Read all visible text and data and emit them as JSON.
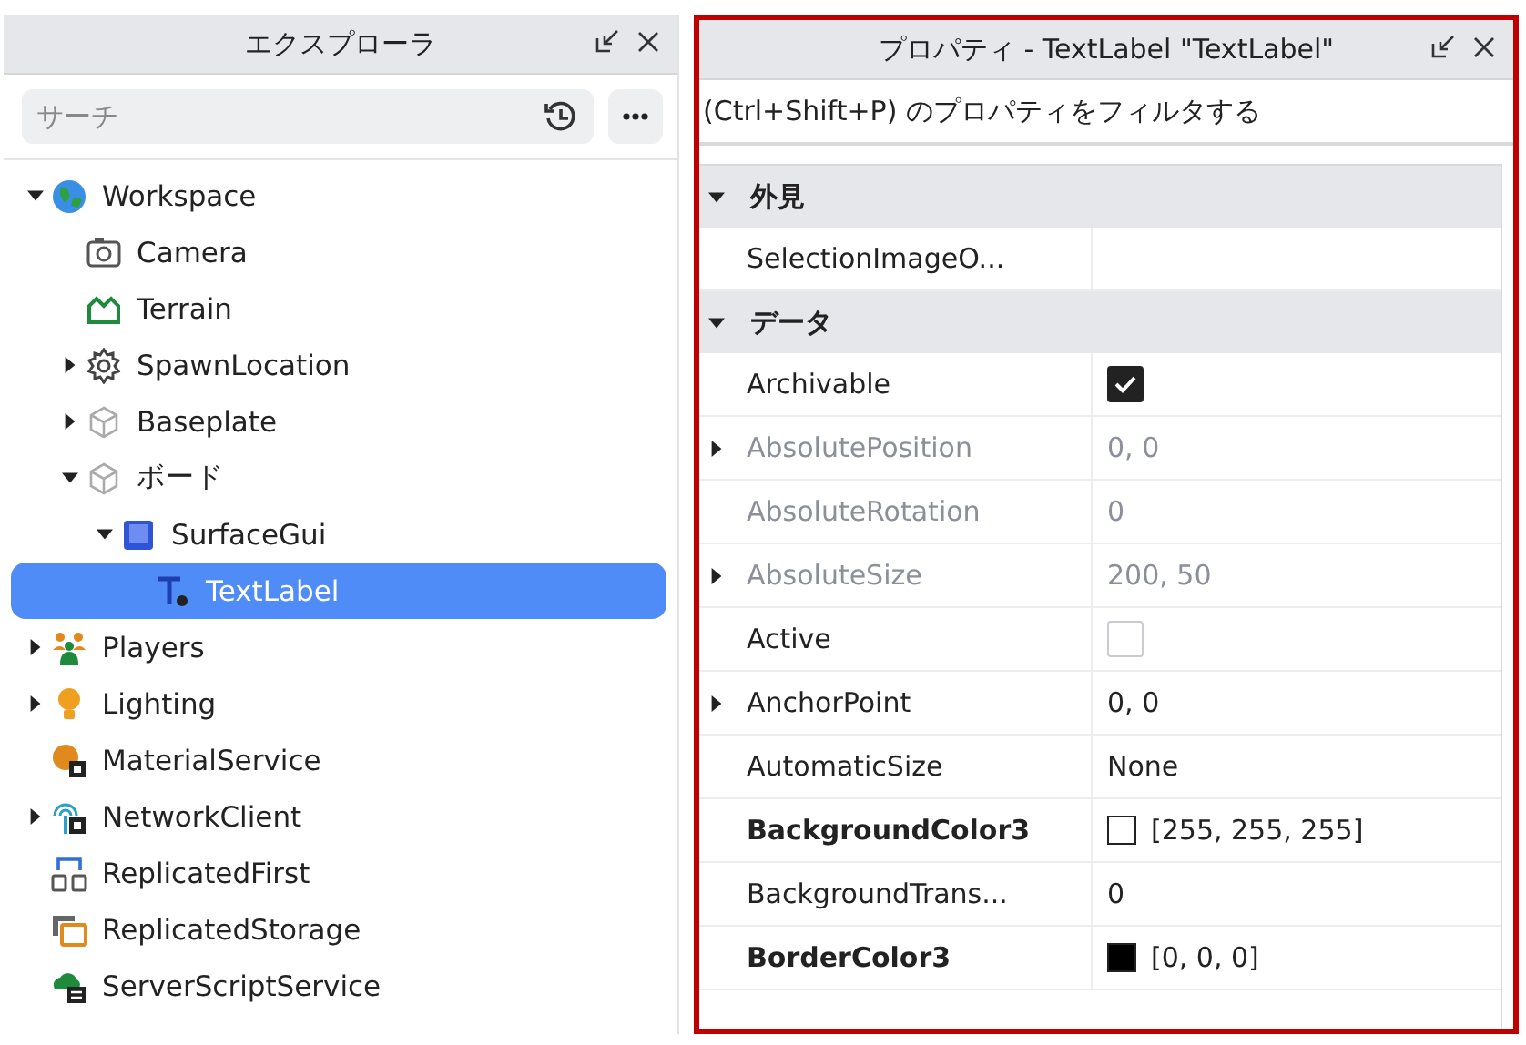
{
  "explorer": {
    "title": "エクスプローラ",
    "search": {
      "placeholder": "サーチ"
    },
    "tree": [
      {
        "label": "Workspace",
        "kind": "globe",
        "expanded": true,
        "selected": false,
        "children": [
          {
            "label": "Camera",
            "kind": "camera",
            "selected": false
          },
          {
            "label": "Terrain",
            "kind": "terrain",
            "selected": false
          },
          {
            "label": "SpawnLocation",
            "kind": "gear",
            "expanded": false,
            "selected": false
          },
          {
            "label": "Baseplate",
            "kind": "cube",
            "expanded": false,
            "selected": false
          },
          {
            "label": "ボード",
            "kind": "cube",
            "expanded": true,
            "selected": false,
            "children": [
              {
                "label": "SurfaceGui",
                "kind": "surface",
                "expanded": true,
                "selected": false,
                "children": [
                  {
                    "label": "TextLabel",
                    "kind": "textlabel",
                    "selected": true
                  }
                ]
              }
            ]
          }
        ]
      },
      {
        "label": "Players",
        "kind": "players",
        "expanded": false,
        "selected": false
      },
      {
        "label": "Lighting",
        "kind": "bulb",
        "expanded": false,
        "selected": false
      },
      {
        "label": "MaterialService",
        "kind": "material",
        "selected": false
      },
      {
        "label": "NetworkClient",
        "kind": "network",
        "expanded": false,
        "selected": false
      },
      {
        "label": "ReplicatedFirst",
        "kind": "replfirst",
        "selected": false
      },
      {
        "label": "ReplicatedStorage",
        "kind": "storage",
        "selected": false
      },
      {
        "label": "ServerScriptService",
        "kind": "script",
        "selected": false
      }
    ]
  },
  "properties": {
    "title": "プロパティ - TextLabel \"TextLabel\"",
    "filter": {
      "placeholder": "(Ctrl+Shift+P) のプロパティをフィルタする"
    },
    "sections": [
      {
        "title": "外見",
        "expanded": true,
        "rows": [
          {
            "name": "SelectionImageO...",
            "kind": "text",
            "value": ""
          }
        ]
      },
      {
        "title": "データ",
        "expanded": true,
        "rows": [
          {
            "name": "Archivable",
            "kind": "checkbox",
            "checked": true
          },
          {
            "name": "AbsolutePosition",
            "kind": "text",
            "value": "0, 0",
            "expandable": true,
            "readonly": true
          },
          {
            "name": "AbsoluteRotation",
            "kind": "text",
            "value": "0",
            "readonly": true
          },
          {
            "name": "AbsoluteSize",
            "kind": "text",
            "value": "200, 50",
            "expandable": true,
            "readonly": true
          },
          {
            "name": "Active",
            "kind": "checkbox",
            "checked": false
          },
          {
            "name": "AnchorPoint",
            "kind": "text",
            "value": "0, 0",
            "expandable": true
          },
          {
            "name": "AutomaticSize",
            "kind": "text",
            "value": "None"
          },
          {
            "name": "BackgroundColor3",
            "kind": "color",
            "color": "#ffffff",
            "value": "[255, 255, 255]",
            "modified": true
          },
          {
            "name": "BackgroundTrans...",
            "kind": "text",
            "value": "0"
          },
          {
            "name": "BorderColor3",
            "kind": "color",
            "color": "#000000",
            "value": "[0, 0, 0]",
            "modified": true
          }
        ]
      }
    ]
  }
}
